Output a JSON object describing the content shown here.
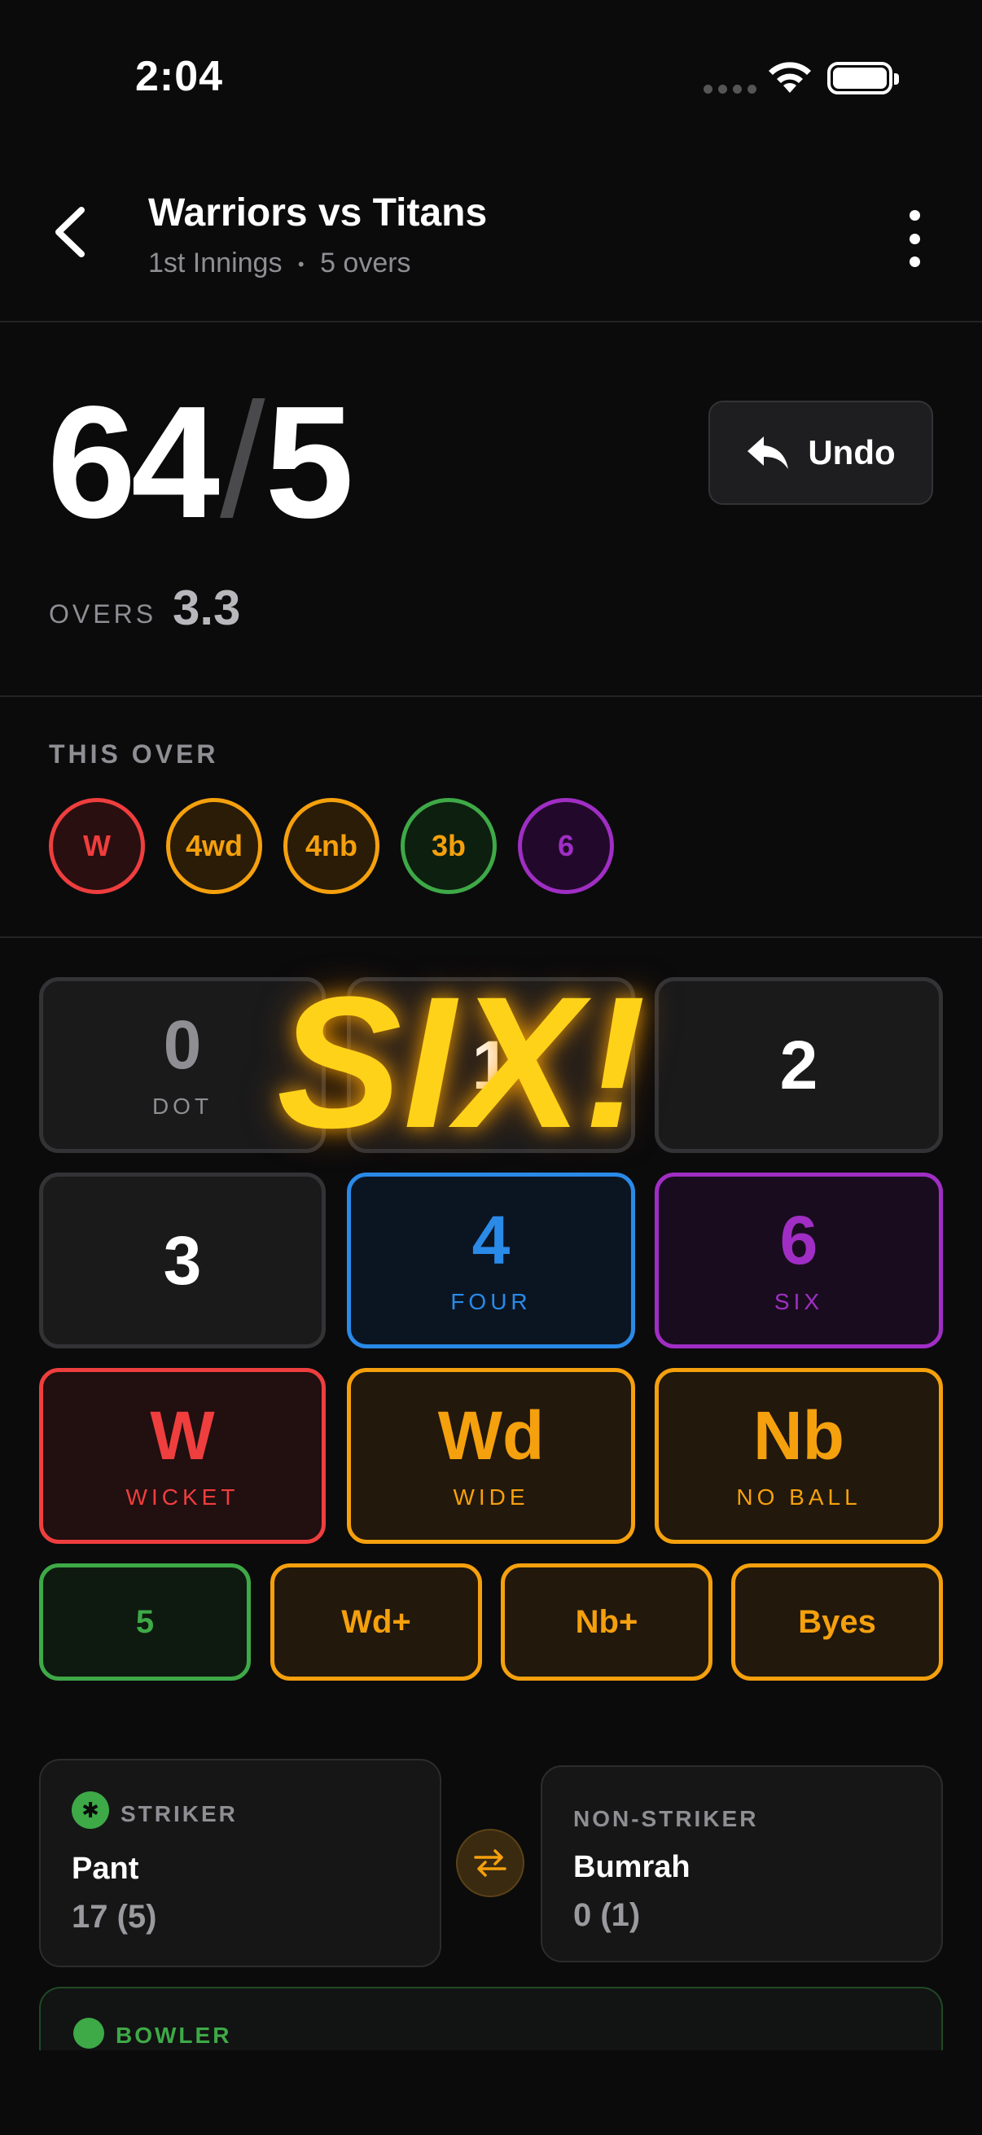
{
  "status_bar": {
    "time": "2:04"
  },
  "header": {
    "title": "Warriors vs Titans",
    "subtitle_innings": "1st Innings",
    "subtitle_sep": "•",
    "subtitle_overs": "5 overs"
  },
  "score": {
    "runs": "64",
    "slash": "/",
    "wickets": "5",
    "overs_label": "OVERS",
    "overs_value": "3.3",
    "undo_label": "Undo"
  },
  "this_over": {
    "label": "THIS OVER",
    "balls": [
      "W",
      "4wd",
      "4nb",
      "3b",
      "6"
    ]
  },
  "keypad": {
    "dot": {
      "value": "0",
      "label": "DOT"
    },
    "one": {
      "value": "1"
    },
    "two": {
      "value": "2"
    },
    "three": {
      "value": "3"
    },
    "four": {
      "value": "4",
      "label": "FOUR"
    },
    "six": {
      "value": "6",
      "label": "SIX"
    },
    "wicket": {
      "value": "W",
      "label": "WICKET"
    },
    "wide": {
      "value": "Wd",
      "label": "WIDE"
    },
    "noball": {
      "value": "Nb",
      "label": "NO BALL"
    },
    "five": "5",
    "wide_plus": "Wd+",
    "noball_plus": "Nb+",
    "byes": "Byes"
  },
  "overlay": {
    "text": "SIX!"
  },
  "striker": {
    "label": "STRIKER",
    "name": "Pant",
    "stat": "17 (5)"
  },
  "non_striker": {
    "label": "NON-STRIKER",
    "name": "Bumrah",
    "stat": "0 (1)"
  },
  "bowler": {
    "label": "BOWLER"
  },
  "colors": {
    "background": "#0b0b0c",
    "wicket": "#ef3e3e",
    "extra": "#f5a00d",
    "four": "#2a8ae8",
    "six": "#a02ec4",
    "green": "#3ea947",
    "overlay": "#ffd21a"
  }
}
